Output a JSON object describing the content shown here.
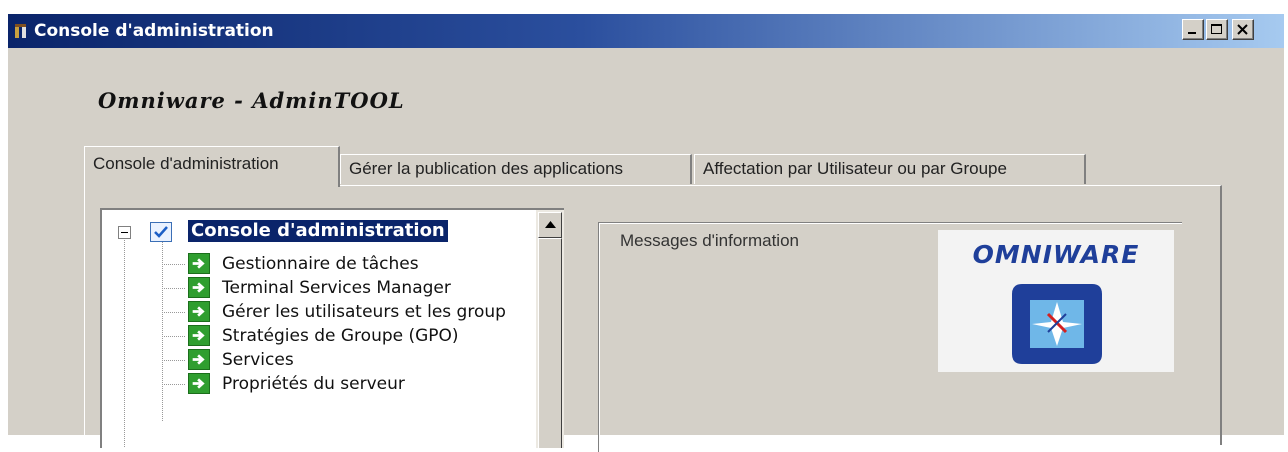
{
  "window": {
    "title": "Console d'administration",
    "controls": {
      "minimize": "minimize",
      "maximize": "maximize",
      "close": "close"
    }
  },
  "header": {
    "app_title": "Omniware - AdminTOOL"
  },
  "tabs": [
    {
      "label": "Console d'administration",
      "active": true
    },
    {
      "label": "Gérer la publication des applications",
      "active": false
    },
    {
      "label": "Affectation par Utilisateur ou par Groupe",
      "active": false
    }
  ],
  "tree": {
    "root": {
      "label": "Console d'administration",
      "checked": true,
      "expanded": true
    },
    "items": [
      {
        "label": "Gestionnaire de tâches",
        "icon": "green-arrow-icon"
      },
      {
        "label": "Terminal Services Manager",
        "icon": "green-arrow-icon"
      },
      {
        "label": "Gérer les utilisateurs et les group",
        "icon": "green-arrow-icon"
      },
      {
        "label": "Stratégies de Groupe (GPO)",
        "icon": "green-arrow-icon"
      },
      {
        "label": "Services",
        "icon": "green-arrow-icon"
      },
      {
        "label": "Propriétés du serveur",
        "icon": "green-arrow-icon"
      }
    ]
  },
  "info_panel": {
    "label": "Messages d'information",
    "logo_text": "OMNIWARE"
  },
  "colors": {
    "title_bar_start": "#0a246a",
    "title_bar_end": "#a6caf0",
    "window_bg": "#d4d0c8",
    "selection": "#0a246a",
    "tree_item_icon": "#2f9e2f",
    "logo_blue": "#1f3f9a"
  }
}
